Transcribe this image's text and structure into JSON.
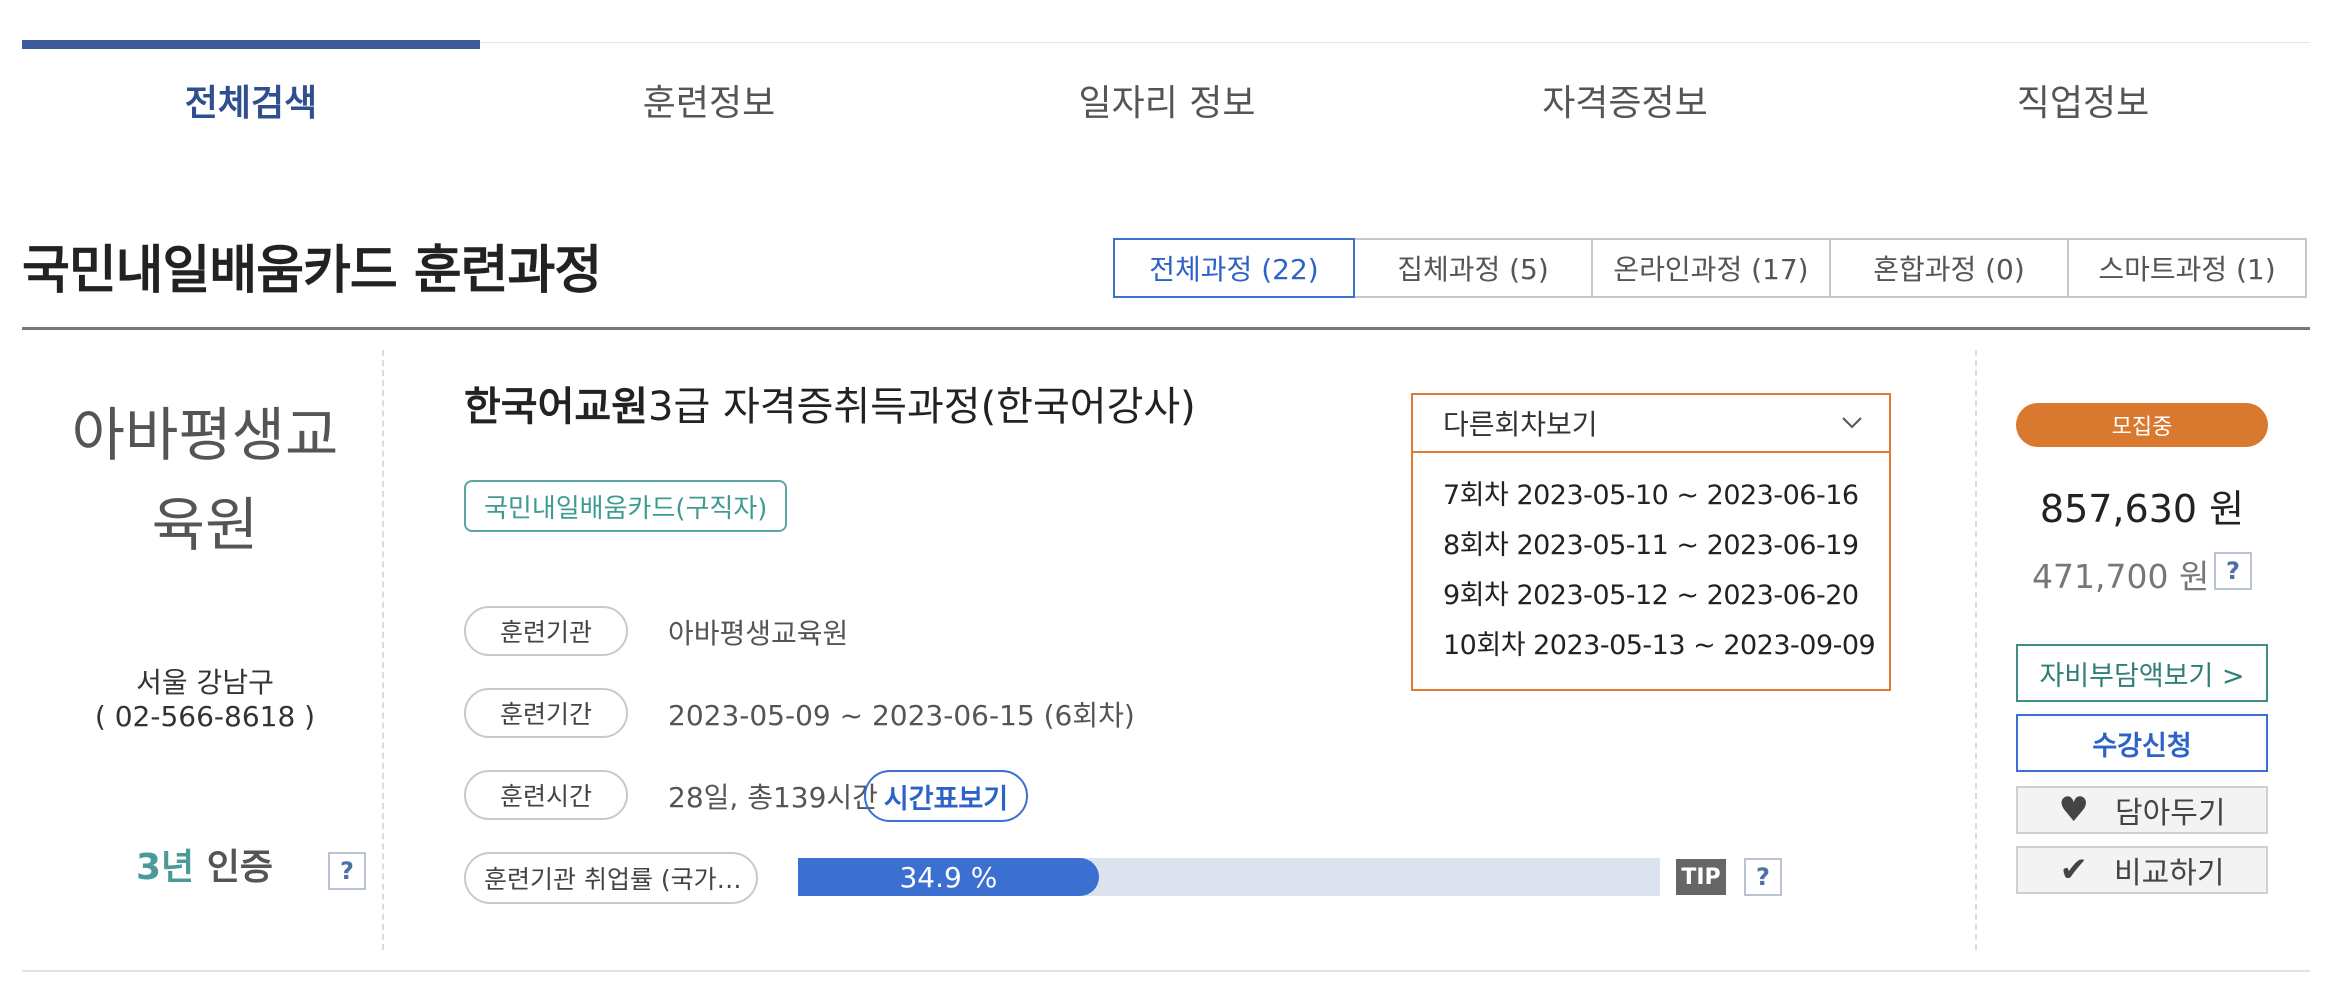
{
  "top_tabs": [
    {
      "label": "전체검색",
      "active": true
    },
    {
      "label": "훈련정보",
      "active": false
    },
    {
      "label": "일자리 정보",
      "active": false
    },
    {
      "label": "자격증정보",
      "active": false
    },
    {
      "label": "직업정보",
      "active": false
    }
  ],
  "page_title": "국민내일배움카드 훈련과정",
  "filter_tabs": [
    {
      "label": "전체과정 (22)",
      "active": true
    },
    {
      "label": "집체과정 (5)",
      "active": false
    },
    {
      "label": "온라인과정 (17)",
      "active": false
    },
    {
      "label": "혼합과정 (0)",
      "active": false
    },
    {
      "label": "스마트과정 (1)",
      "active": false
    }
  ],
  "course": {
    "institution": {
      "name_line1": "아바평생교",
      "name_line2": "육원",
      "region": "서울 강남구",
      "phone": "( 02-566-8618 )",
      "cert_number": "3년",
      "cert_text": "인증",
      "help": "?"
    },
    "title_bold": "한국어교원",
    "title_rest": "3급 자격증취득과정(한국어강사)",
    "card_type": "국민내일배움카드(구직자)",
    "info": {
      "institution_label": "훈련기관",
      "institution_value": "아바평생교육원",
      "period_label": "훈련기간",
      "period_value": "2023-05-09 ~ 2023-06-15 (6회차)",
      "hours_label": "훈련시간",
      "hours_value": "28일, 총139시간",
      "timetable_button": "시간표보기"
    },
    "employment": {
      "label": "훈련기관 취업률 (국가…",
      "rate_text": "34.9 %",
      "rate_percent": 34.9,
      "tip": "TIP",
      "help": "?"
    },
    "sessions_dropdown": {
      "placeholder": "다른회차보기",
      "items": [
        "7회차 2023-05-10 ~ 2023-06-16",
        "8회차 2023-05-11 ~ 2023-06-19",
        "9회차 2023-05-12 ~ 2023-06-20",
        "10회차 2023-05-13 ~ 2023-09-09"
      ]
    },
    "side": {
      "status": "모집중",
      "price": "857,630 원",
      "self_pay": "471,700 원",
      "help": "?",
      "self_pay_button": "자비부담액보기 >",
      "apply_button": "수강신청",
      "wishlist_button": "담아두기",
      "compare_button": "비교하기"
    }
  },
  "colors": {
    "primary_blue": "#3b6fd0",
    "nav_active": "#3d5a99",
    "recruit_orange": "#d9792f",
    "teal": "#3f9b91",
    "dropdown_border": "#de7a32"
  }
}
